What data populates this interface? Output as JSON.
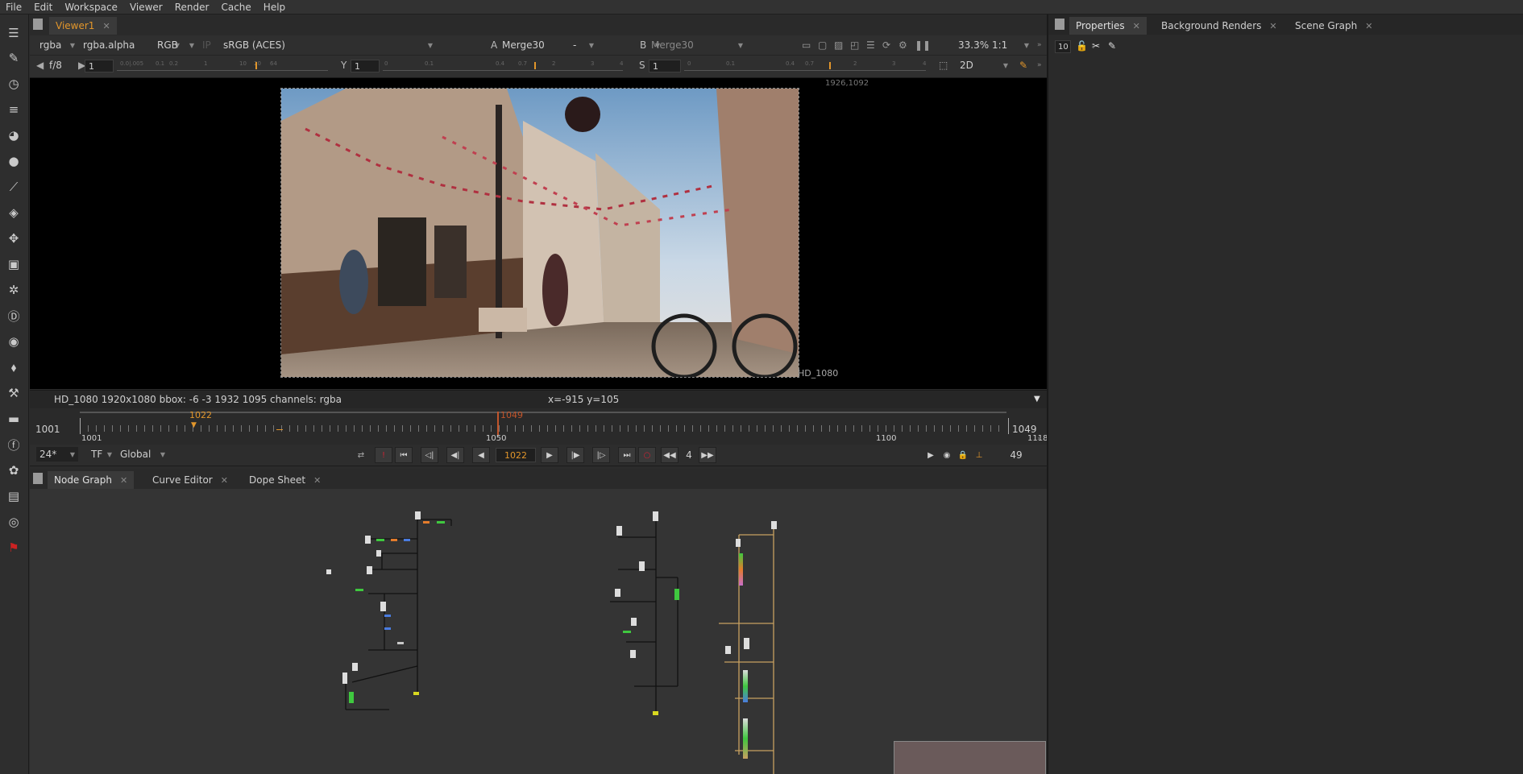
{
  "menu": [
    "File",
    "Edit",
    "Workspace",
    "Viewer",
    "Render",
    "Cache",
    "Help"
  ],
  "viewer": {
    "tab_label": "Viewer1",
    "channels": "rgba",
    "alpha": "rgba.alpha",
    "display": "RGB",
    "ip": "IP",
    "lut": "sRGB (ACES)",
    "input_a_label": "A",
    "input_a": "Merge30",
    "compare": "-",
    "input_b_label": "B",
    "input_b": "Merge30",
    "zoom": "33.3%",
    "ratio": "1:1",
    "fstop": "f/8",
    "gain": "1",
    "gamma_label": "Y",
    "gamma": "1",
    "sat_label": "S",
    "sat": "1",
    "view_mode": "2D",
    "format_tr": "1926,1092",
    "format_br": "HD_1080",
    "status_info": "HD_1080 1920x1080  bbox: -6 -3 1932 1095 channels: rgba",
    "cursor": "x=-915 y=105"
  },
  "timeline": {
    "start": "1001",
    "end": "1049",
    "marker_in": "1022",
    "marker_out": "1049",
    "tick_labels": [
      "1001",
      "1050",
      "1100",
      "1118"
    ],
    "fps": "24*",
    "tf": "TF",
    "scope": "Global",
    "current_frame": "1022",
    "step": "4",
    "frame_count": "49"
  },
  "node_tabs": [
    "Node Graph",
    "Curve Editor",
    "Dope Sheet"
  ],
  "right_tabs": [
    "Properties",
    "Background Renders",
    "Scene Graph"
  ],
  "properties": {
    "max_panels": "10"
  }
}
